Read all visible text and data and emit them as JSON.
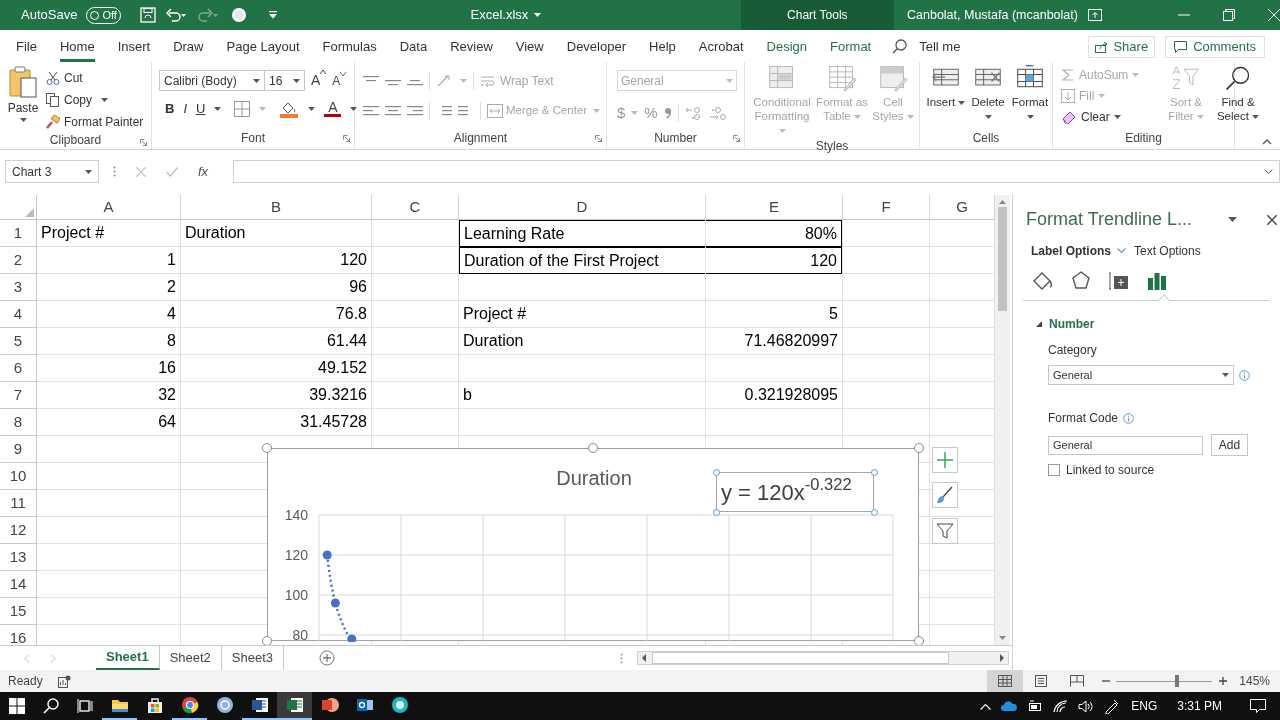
{
  "title_bar": {
    "autosave_label": "AutoSave",
    "autosave_state": "Off",
    "autosave_on": false,
    "redo_disabled": true,
    "file_name": "Excel.xlsx",
    "context_tab": "Chart Tools",
    "user": "Canbolat, Mustafa (mcanbolat)"
  },
  "menu_tabs": [
    {
      "label": "File",
      "selected": false,
      "kind": "plain"
    },
    {
      "label": "Home",
      "selected": true,
      "kind": "plain"
    },
    {
      "label": "Insert",
      "selected": false,
      "kind": "plain"
    },
    {
      "label": "Draw",
      "selected": false,
      "kind": "plain"
    },
    {
      "label": "Page Layout",
      "selected": false,
      "kind": "plain"
    },
    {
      "label": "Formulas",
      "selected": false,
      "kind": "plain"
    },
    {
      "label": "Data",
      "selected": false,
      "kind": "plain"
    },
    {
      "label": "Review",
      "selected": false,
      "kind": "plain"
    },
    {
      "label": "View",
      "selected": false,
      "kind": "plain"
    },
    {
      "label": "Developer",
      "selected": false,
      "kind": "plain"
    },
    {
      "label": "Help",
      "selected": false,
      "kind": "plain"
    },
    {
      "label": "Acrobat",
      "selected": false,
      "kind": "plain"
    },
    {
      "label": "Design",
      "selected": false,
      "kind": "context"
    },
    {
      "label": "Format",
      "selected": false,
      "kind": "context"
    }
  ],
  "tell_me": "Tell me",
  "share": "Share",
  "comments": "Comments",
  "ribbon": {
    "clipboard": {
      "label": "Clipboard",
      "paste": "Paste",
      "cut": "Cut",
      "copy": "Copy",
      "format_painter": "Format Painter"
    },
    "font": {
      "label": "Font",
      "font_name": "Calibri (Body)",
      "font_size": "16",
      "grow": "A",
      "shrink": "A",
      "bold": "B",
      "italic": "I",
      "underline": "U",
      "font_color": "A"
    },
    "alignment": {
      "label": "Alignment",
      "wrap_text": {
        "label": "Wrap Text",
        "disabled": true
      },
      "merge": {
        "label": "Merge & Center",
        "disabled": true
      }
    },
    "number": {
      "label": "Number",
      "format": {
        "value": "General",
        "disabled": true
      },
      "currency": "$",
      "percent": "%"
    },
    "styles": {
      "label": "Styles",
      "items": [
        {
          "label": "Conditional Formatting",
          "disabled": true,
          "kind": "conditional"
        },
        {
          "label": "Format as Table",
          "disabled": true,
          "kind": "table"
        },
        {
          "label": "Cell Styles",
          "disabled": true,
          "kind": "styles"
        }
      ]
    },
    "cells": {
      "label": "Cells",
      "items": [
        {
          "label": "Insert",
          "disabled": false,
          "kind": "insert"
        },
        {
          "label": "Delete",
          "disabled": false,
          "kind": "delete"
        },
        {
          "label": "Format",
          "disabled": false,
          "kind": "format"
        }
      ]
    },
    "editing": {
      "label": "Editing",
      "small": [
        {
          "label": "AutoSum",
          "disabled": true,
          "kind": "sum"
        },
        {
          "label": "Fill",
          "disabled": true,
          "kind": "fill"
        },
        {
          "label": "Clear",
          "disabled": false,
          "kind": "clear"
        }
      ],
      "large": [
        {
          "label": "Sort & Filter",
          "disabled": true,
          "kind": "sort"
        },
        {
          "label": "Find & Select",
          "disabled": false,
          "kind": "find"
        }
      ]
    }
  },
  "formula_bar": {
    "name_box": "Chart 3",
    "fx": "fx",
    "buttons_disabled": true
  },
  "sheet": {
    "columns": [
      "A",
      "B",
      "C",
      "D",
      "E",
      "F",
      "G"
    ],
    "rows": [
      {
        "number": "1",
        "a": {
          "text": "Project #",
          "kind": "text",
          "bordered": false
        },
        "b": {
          "text": "Duration",
          "kind": "text",
          "bordered": false
        },
        "d": {
          "text": "Learning Rate",
          "kind": "text",
          "bordered": true
        },
        "e": {
          "text": "80%",
          "kind": "number",
          "bordered": true
        }
      },
      {
        "number": "2",
        "a": {
          "text": "1",
          "kind": "number",
          "bordered": false
        },
        "b": {
          "text": "120",
          "kind": "number",
          "bordered": false
        },
        "d": {
          "text": "Duration of the First Project",
          "kind": "text",
          "bordered": true
        },
        "e": {
          "text": "120",
          "kind": "number",
          "bordered": true
        }
      },
      {
        "number": "3",
        "a": {
          "text": "2",
          "kind": "number",
          "bordered": false
        },
        "b": {
          "text": "96",
          "kind": "number",
          "bordered": false
        }
      },
      {
        "number": "4",
        "a": {
          "text": "4",
          "kind": "number",
          "bordered": false
        },
        "b": {
          "text": "76.8",
          "kind": "number",
          "bordered": false
        },
        "d": {
          "text": "Project #",
          "kind": "text",
          "bordered": false
        },
        "e": {
          "text": "5",
          "kind": "number",
          "bordered": false
        }
      },
      {
        "number": "5",
        "a": {
          "text": "8",
          "kind": "number",
          "bordered": false
        },
        "b": {
          "text": "61.44",
          "kind": "number",
          "bordered": false
        },
        "d": {
          "text": "Duration",
          "kind": "text",
          "bordered": false
        },
        "e": {
          "text": "71.46820997",
          "kind": "number",
          "bordered": false
        }
      },
      {
        "number": "6",
        "a": {
          "text": "16",
          "kind": "number",
          "bordered": false
        },
        "b": {
          "text": "49.152",
          "kind": "number",
          "bordered": false
        }
      },
      {
        "number": "7",
        "a": {
          "text": "32",
          "kind": "number",
          "bordered": false
        },
        "b": {
          "text": "39.3216",
          "kind": "number",
          "bordered": false
        },
        "d": {
          "text": "b",
          "kind": "text",
          "bordered": false
        },
        "e": {
          "text": "0.321928095",
          "kind": "number",
          "bordered": false
        }
      },
      {
        "number": "8",
        "a": {
          "text": "64",
          "kind": "number",
          "bordered": false
        },
        "b": {
          "text": "31.45728",
          "kind": "number",
          "bordered": false
        }
      },
      {
        "number": "9"
      },
      {
        "number": "10"
      },
      {
        "number": "11"
      },
      {
        "number": "12"
      },
      {
        "number": "13"
      },
      {
        "number": "14"
      },
      {
        "number": "15"
      },
      {
        "number": "16"
      }
    ]
  },
  "chart": {
    "selected": true,
    "title": "Duration",
    "y_axis_labels": [
      "140",
      "120",
      "100",
      "80"
    ],
    "trendline_label": "y = 120x$^{-0.322}$"
  },
  "pane": {
    "title": "Format Trendline L...",
    "tabs": [
      {
        "label": "Label Options",
        "selected": true
      },
      {
        "label": "Text Options",
        "selected": false
      }
    ],
    "icon_tabs": [
      {
        "kind": "fill",
        "selected": false
      },
      {
        "kind": "effects",
        "selected": false
      },
      {
        "kind": "size",
        "selected": false
      },
      {
        "kind": "options",
        "selected": true
      }
    ],
    "section": {
      "label": "Number",
      "expanded": true
    },
    "category_label": "Category",
    "category_value": "General",
    "format_code_label": "Format Code",
    "format_code_value": "General",
    "add": "Add",
    "linked_label": "Linked to source",
    "linked_checked": false
  },
  "sheet_tabs": [
    {
      "label": "Sheet1",
      "selected": true
    },
    {
      "label": "Sheet2",
      "selected": false
    },
    {
      "label": "Sheet3",
      "selected": false
    }
  ],
  "status_bar": {
    "ready": "Ready",
    "views": [
      {
        "kind": "normal",
        "selected": true
      },
      {
        "kind": "page_layout",
        "selected": false
      },
      {
        "kind": "page_break",
        "selected": false
      }
    ],
    "zoom": {
      "level": 0.63,
      "reading": "145%"
    }
  },
  "taskbar": {
    "apps": [
      {
        "kind": "explorer",
        "running": true,
        "active": false
      },
      {
        "kind": "store",
        "running": false,
        "active": false
      },
      {
        "kind": "browser",
        "running": true,
        "active": false
      },
      {
        "kind": "r",
        "running": false,
        "active": false
      },
      {
        "kind": "word",
        "running": true,
        "active": false
      },
      {
        "kind": "excel",
        "running": true,
        "active": true
      },
      {
        "kind": "powerpoint",
        "running": false,
        "active": false
      },
      {
        "kind": "outlook",
        "running": false,
        "active": false
      },
      {
        "kind": "other",
        "running": false,
        "active": false
      }
    ],
    "language": "ENG",
    "time": "3:31 PM"
  }
}
